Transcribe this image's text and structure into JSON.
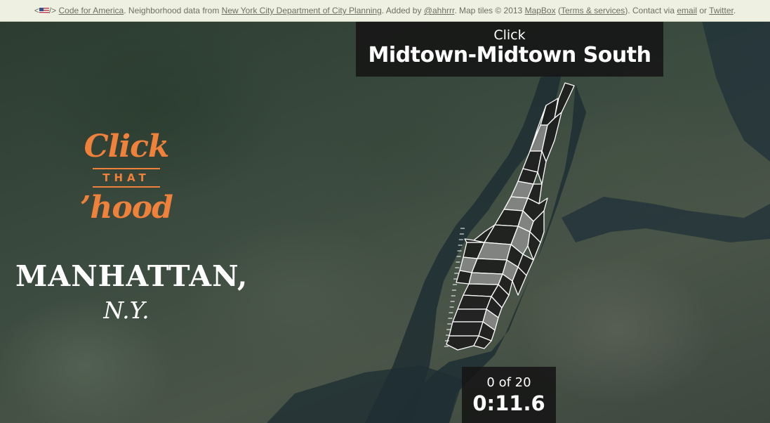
{
  "attribution": {
    "prefix": "<",
    "flag_suffix": "/>",
    "link_cfa": "Code for America",
    "text_1": ". Neighborhood data from ",
    "link_nyc": "New York City Department of City Planning",
    "text_2": ". Added by ",
    "link_author": "@ahhrrr",
    "text_3": ". Map tiles © 2013 ",
    "link_mapbox": "MapBox",
    "text_4": " (",
    "link_terms": "Terms & services",
    "text_5": "). Contact via ",
    "link_email": "email",
    "text_6": " or ",
    "link_twitter": "Twitter",
    "text_7": "."
  },
  "prompt": {
    "verb": "Click",
    "target": "Midtown-Midtown South"
  },
  "logo": {
    "click": "Click",
    "that": "THAT",
    "hood": "’hood"
  },
  "city": {
    "name": "MANHATTAN,",
    "state": "N.Y."
  },
  "counter": {
    "progress": "0 of 20",
    "time": "0:11.6"
  },
  "colors": {
    "accent": "#f0813b",
    "panel": "#161616",
    "hood_dark": "#1c1c1c",
    "hood_light": "#8c8c8c",
    "hood_stroke": "#ffffff"
  }
}
